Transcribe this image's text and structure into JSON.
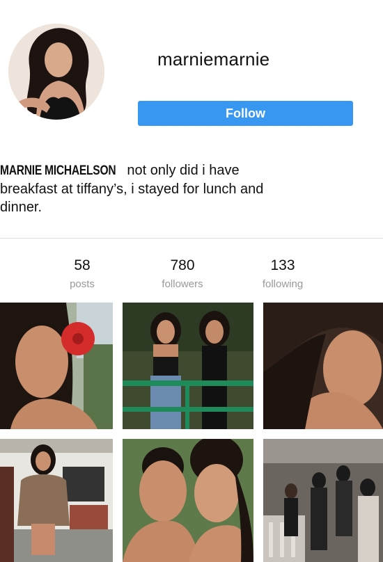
{
  "profile": {
    "username": "marniemarnie",
    "follow_label": "Follow",
    "bio_name": "MARNIE MICHAELSON",
    "bio_text": " not only did i have breakfast at tiffany’s, i stayed for lunch and dinner."
  },
  "stats": [
    {
      "value": "58",
      "label": "posts"
    },
    {
      "value": "780",
      "label": "followers"
    },
    {
      "value": "133",
      "label": "following"
    }
  ],
  "colors": {
    "follow_button": "#3897f0",
    "stat_label": "#999999",
    "divider": "#dbdbdb"
  }
}
